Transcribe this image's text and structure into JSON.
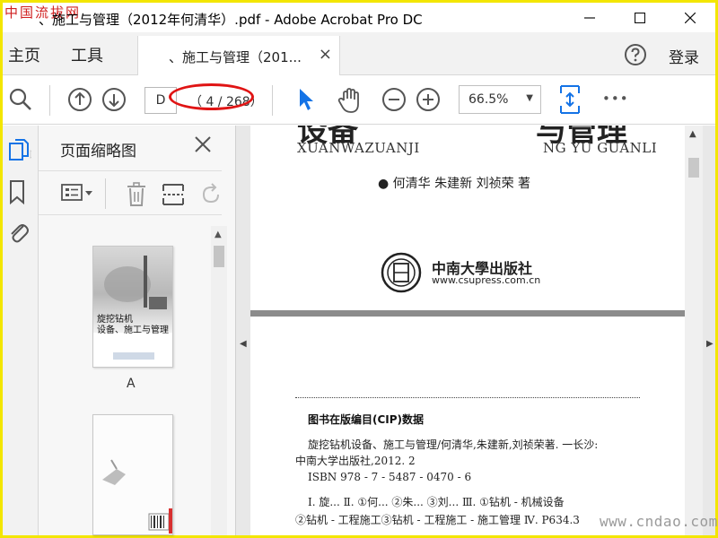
{
  "window": {
    "title": "、施工与管理（2012年何清华）.pdf - Adobe Acrobat Pro DC",
    "site_logo": "中国流拔网"
  },
  "menu": {
    "home": "主页",
    "tools": "工具",
    "tab_label": "、施工与管理（201...",
    "tab_close": "×",
    "login": "登录"
  },
  "toolbar": {
    "page_current": "D",
    "page_count": "（ 4 / 268）",
    "zoom": "66.5%",
    "zoom_caret": "▼",
    "more": "•••"
  },
  "thumbnails": {
    "title": "页面缩略图",
    "thumb1_label": "A",
    "thumb1_cover_title": "旋挖钻机\n设备、施工与管理"
  },
  "document": {
    "page1": {
      "title_left": "设备",
      "title_right": "与管理",
      "pinyin_left": "XUANWAZUANJI",
      "pinyin_right": "NG YU GUANLI",
      "authors": "● 何清华 朱建新 刘祯荣 著",
      "publisher": "中南大學出版社",
      "publisher_url": "www.csupress.com.cn"
    },
    "page2": {
      "cip_heading": "图书在版编目(CIP)数据",
      "lines": [
        "旋挖钻机设备、施工与管理/何清华,朱建新,刘祯荣著. 一长沙:",
        "中南大学出版社,2012. 2",
        "ISBN 978 - 7 - 5487 - 0470 - 6",
        "Ⅰ. 旋... Ⅱ. ①何... ②朱... ③刘...    Ⅲ. ①钻机 - 机械设备",
        "②钻机 - 工程施工③钻机 - 工程施工 - 施工管理   Ⅳ. P634.3"
      ]
    }
  },
  "watermark": "www.cndao.com",
  "colors": {
    "frame": "#f3e600",
    "accent": "#1473e6",
    "annotation": "#e01414"
  }
}
